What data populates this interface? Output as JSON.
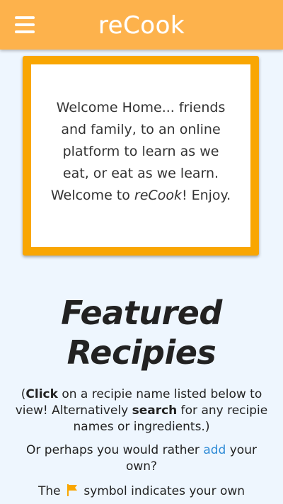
{
  "appbar": {
    "brand": "reCook",
    "menu_icon": "hamburger-menu-icon",
    "background_color": "#fdb24c"
  },
  "welcome": {
    "text_before": "Welcome Home... friends and family, to an online platform to learn as we eat, or eat as we learn. Welcome to ",
    "brand_emphasis": "reCook",
    "text_after": "! Enjoy.",
    "border_color": "#f9a602"
  },
  "featured": {
    "title": "Featured Recipies"
  },
  "instructions": {
    "open_paren": "(",
    "click_bold": "Click",
    "part1": " on a recipie name listed below to view! Alternatively ",
    "search_bold": "search",
    "part2": " for any recipie names or ingredients.)"
  },
  "add_line": {
    "before": "Or perhaps you would rather ",
    "link": "add",
    "after": " your own?"
  },
  "flag_line": {
    "before": "The ",
    "icon": "flag-icon",
    "after": " symbol indicates your own"
  },
  "colors": {
    "link": "#2e8bd6",
    "page_background": "#eef6fe",
    "flag": "#f9a602"
  }
}
